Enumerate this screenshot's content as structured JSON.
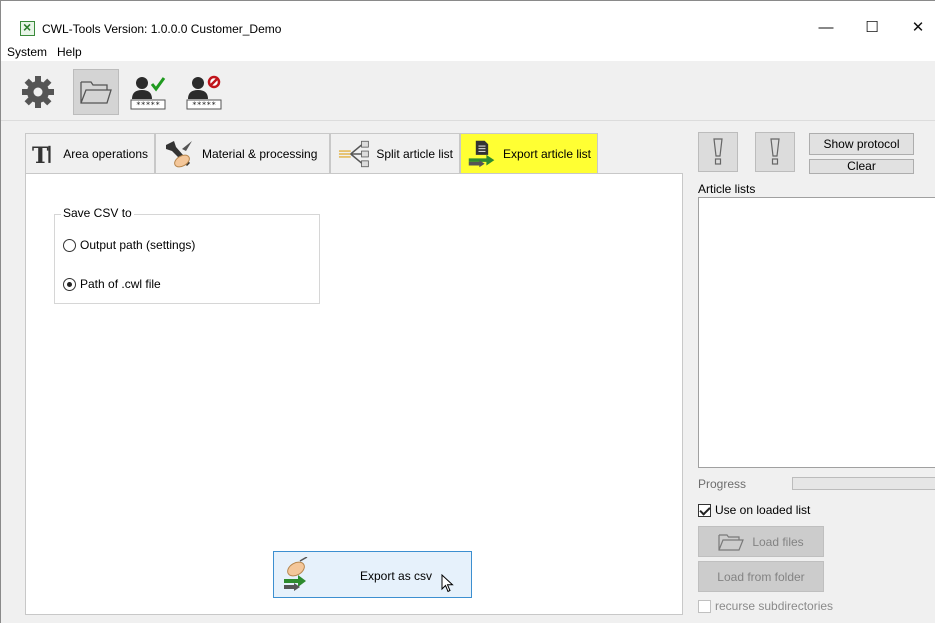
{
  "window": {
    "title": "CWL-Tools  Version: 1.0.0.0  Customer_Demo",
    "minimize": "—",
    "maximize": "☐",
    "close": "✕"
  },
  "menu": [
    "System",
    "Help"
  ],
  "toolbar": {
    "buttons": [
      {
        "name": "settings",
        "icon": "gear-icon",
        "pressed": false
      },
      {
        "name": "open-folder",
        "icon": "folder-icon",
        "pressed": true
      },
      {
        "name": "login",
        "icon": "user-check-icon",
        "pressed": false
      },
      {
        "name": "logout",
        "icon": "user-blocked-icon",
        "pressed": false
      }
    ],
    "password_mask": "*****"
  },
  "tabs": [
    {
      "label": "Area operations",
      "icon": "text-tool-icon",
      "active": false
    },
    {
      "label": "Material & processing",
      "icon": "tools-icon",
      "active": false
    },
    {
      "label": "Split article list",
      "icon": "split-icon",
      "active": false
    },
    {
      "label": "Export article list",
      "icon": "export-icon",
      "active": true
    }
  ],
  "save_csv": {
    "group_title": "Save CSV to",
    "options": [
      {
        "label": "Output path (settings)",
        "checked": false
      },
      {
        "label": "Path of .cwl file",
        "checked": true
      }
    ]
  },
  "export_button": {
    "label": "Export as csv"
  },
  "right_panel": {
    "show_protocol": "Show protocol",
    "clear": "Clear",
    "article_lists_label": "Article lists",
    "progress_label": "Progress",
    "progress_value": 0,
    "use_on_loaded_list": {
      "label": "Use on loaded list",
      "checked": true
    },
    "load_files": "Load files",
    "load_from_folder": "Load from folder",
    "recurse": {
      "label": "recurse subdirectories",
      "checked": false
    }
  },
  "colors": {
    "active_tab": "#ffff33",
    "export_border": "#3c8fd0",
    "export_bg": "#e6f1fb"
  }
}
